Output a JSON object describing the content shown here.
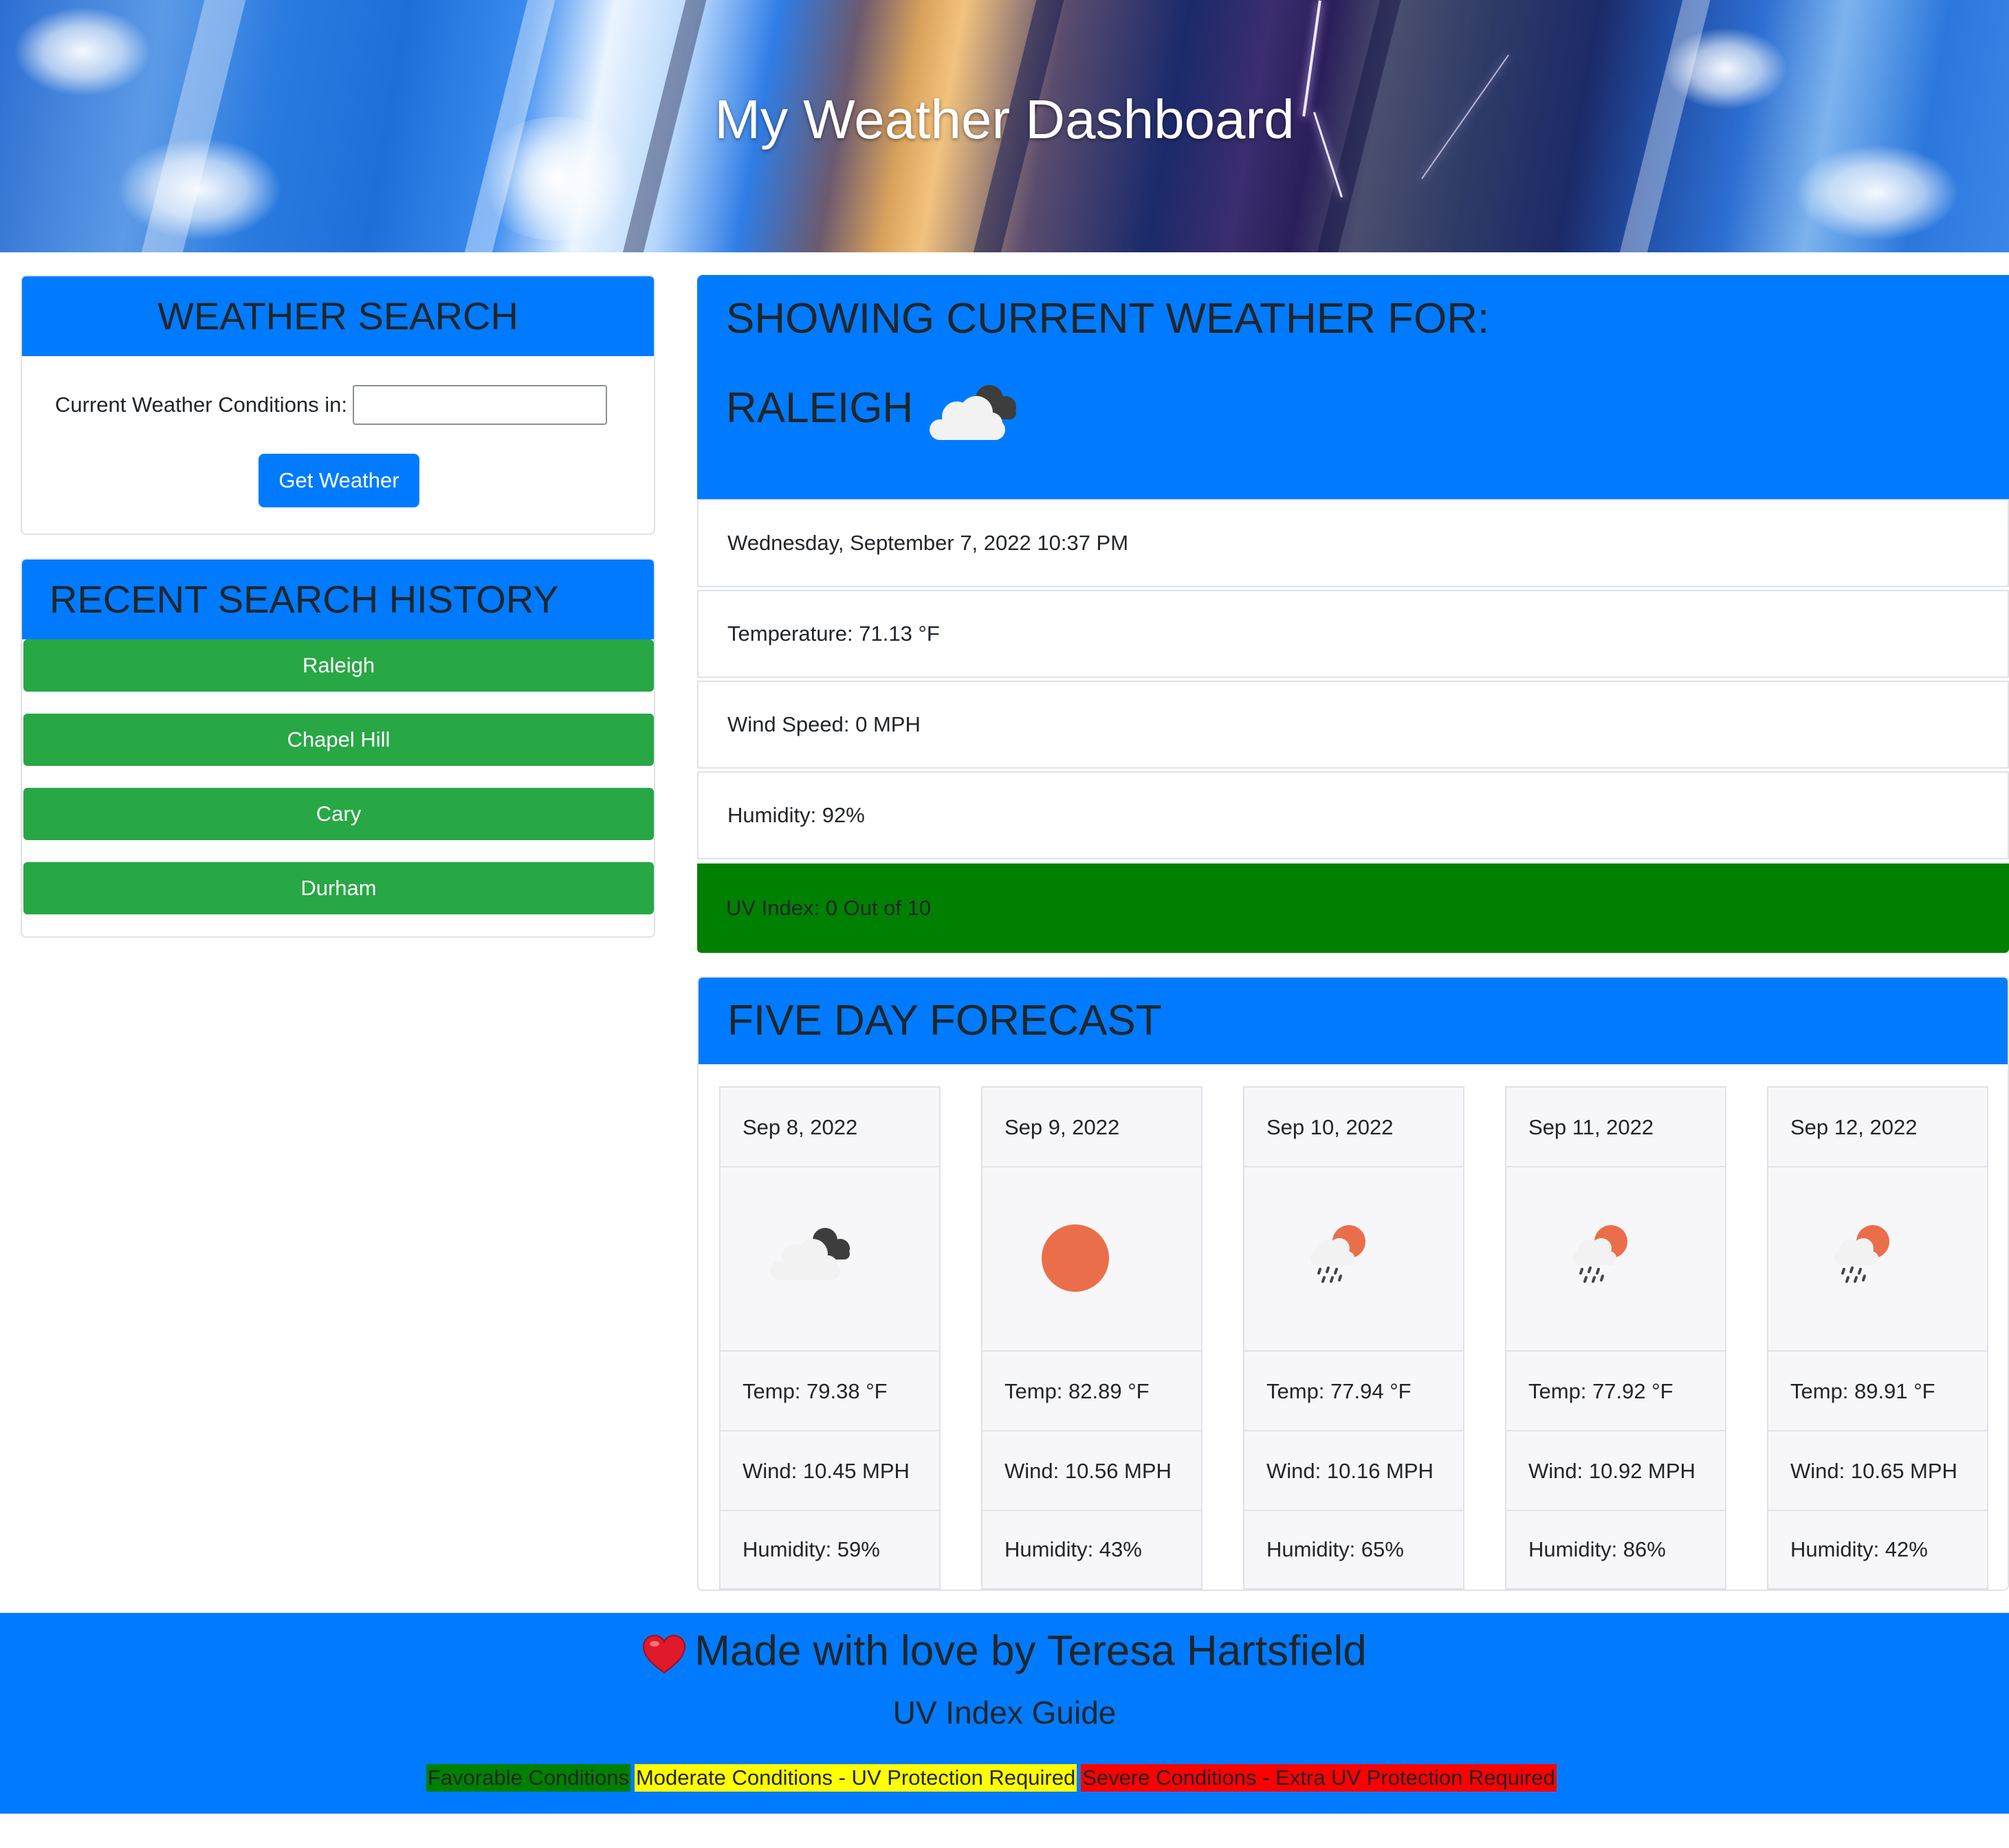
{
  "header": {
    "title": "My Weather Dashboard"
  },
  "search": {
    "heading": "WEATHER SEARCH",
    "label": "Current Weather Conditions in:",
    "input_value": "",
    "button": "Get Weather"
  },
  "history": {
    "heading": "RECENT SEARCH HISTORY",
    "items": [
      "Raleigh",
      "Chapel Hill",
      "Cary",
      "Durham"
    ]
  },
  "current": {
    "heading": "SHOWING CURRENT WEATHER FOR:",
    "city": "RALEIGH",
    "icon": "cloud-night-icon",
    "datetime": "Wednesday, September 7, 2022 10:37 PM",
    "temperature": "Temperature: 71.13 °F",
    "wind": "Wind Speed: 0 MPH",
    "humidity": "Humidity: 92%",
    "uv": "UV Index: 0 Out of 10",
    "uv_color": "#008000"
  },
  "forecast": {
    "heading": "FIVE DAY FORECAST",
    "days": [
      {
        "date": "Sep 8, 2022",
        "icon": "cloud-night-icon",
        "temp": "Temp: 79.38 °F",
        "wind": "Wind: 10.45 MPH",
        "humidity": "Humidity: 59%"
      },
      {
        "date": "Sep 9, 2022",
        "icon": "sun-icon",
        "temp": "Temp: 82.89 °F",
        "wind": "Wind: 10.56 MPH",
        "humidity": "Humidity: 43%"
      },
      {
        "date": "Sep 10, 2022",
        "icon": "rain-sun-icon",
        "temp": "Temp: 77.94 °F",
        "wind": "Wind: 10.16 MPH",
        "humidity": "Humidity: 65%"
      },
      {
        "date": "Sep 11, 2022",
        "icon": "rain-sun-icon",
        "temp": "Temp: 77.92 °F",
        "wind": "Wind: 10.92 MPH",
        "humidity": "Humidity: 86%"
      },
      {
        "date": "Sep 12, 2022",
        "icon": "rain-sun-icon",
        "temp": "Temp: 89.91 °F",
        "wind": "Wind: 10.65 MPH",
        "humidity": "Humidity: 42%"
      }
    ]
  },
  "footer": {
    "credit": "Made with love by Teresa Hartsfield",
    "guide_title": "UV Index Guide",
    "legend": [
      {
        "label": "Favorable Conditions",
        "color": "#008000"
      },
      {
        "label": "Moderate Conditions - UV Protection Required",
        "color": "#ffff00"
      },
      {
        "label": "Severe Conditions - Extra UV Protection Required",
        "color": "#ff0000"
      }
    ]
  },
  "colors": {
    "primary": "#007bff",
    "success": "#28a745"
  }
}
